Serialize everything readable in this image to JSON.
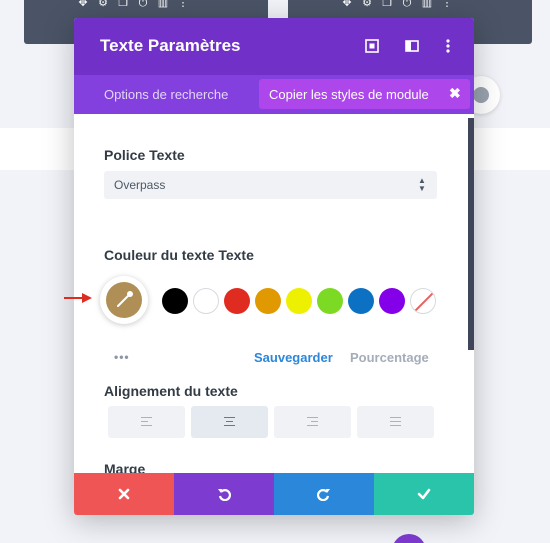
{
  "modal": {
    "title": "Texte Paramètres",
    "tabs": {
      "options": "Options de recherche",
      "copy_styles": "Copier les styles de module"
    },
    "font": {
      "label": "Police Texte",
      "value": "Overpass"
    },
    "text_color": {
      "label": "Couleur du texte Texte",
      "current_color": "#b08f56",
      "swatches": [
        "#000000",
        "#ffffff",
        "#e02b20",
        "#e09900",
        "#edf000",
        "#7cda24",
        "#0c71c3",
        "#8300e9",
        "none"
      ],
      "save_label": "Sauvegarder",
      "percent_label": "Pourcentage"
    },
    "alignment": {
      "label": "Alignement du texte",
      "options": [
        "left",
        "center",
        "right",
        "justify"
      ],
      "selected": "center"
    },
    "margin": {
      "label": "Marge"
    },
    "footer": {
      "colors": {
        "cancel": "#ef5555",
        "undo": "#7e3bd0",
        "redo": "#2b87da",
        "save": "#29c4a9"
      }
    }
  },
  "colors": {
    "header": "#7131c9",
    "tabs_bar": "#8340df",
    "copy_pill": "#ad46eb"
  }
}
